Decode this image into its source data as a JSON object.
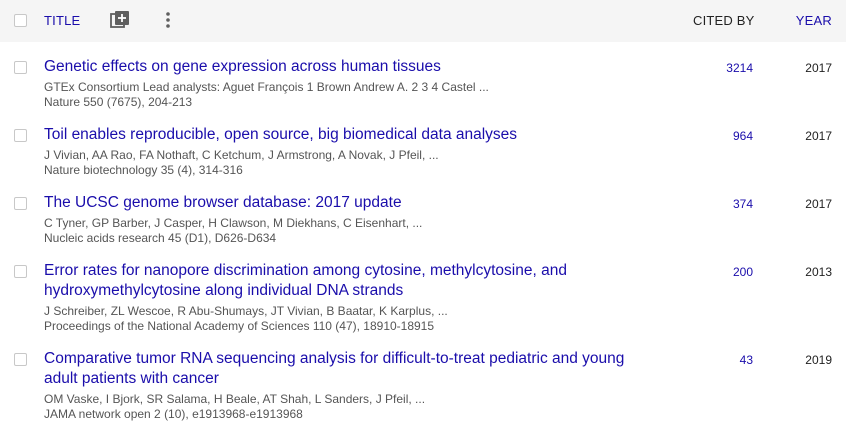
{
  "header": {
    "title_label": "TITLE",
    "cited_by_label": "CITED BY",
    "year_label": "YEAR",
    "icons": [
      "add-article-icon",
      "more-vert-icon"
    ]
  },
  "articles": [
    {
      "title": "Genetic effects on gene expression across human tissues",
      "authors": "GTEx Consortium Lead analysts: Aguet François 1 Brown Andrew A. 2 3 4 Castel ...",
      "source": "Nature 550 (7675), 204-213",
      "cited_by": "3214",
      "year": "2017"
    },
    {
      "title": "Toil enables reproducible, open source, big biomedical data analyses",
      "authors": "J Vivian, AA Rao, FA Nothaft, C Ketchum, J Armstrong, A Novak, J Pfeil, ...",
      "source": "Nature biotechnology 35 (4), 314-316",
      "cited_by": "964",
      "year": "2017"
    },
    {
      "title": "The UCSC genome browser database: 2017 update",
      "authors": "C Tyner, GP Barber, J Casper, H Clawson, M Diekhans, C Eisenhart, ...",
      "source": "Nucleic acids research 45 (D1), D626-D634",
      "cited_by": "374",
      "year": "2017"
    },
    {
      "title_line1": "Error rates for nanopore discrimination among cytosine, methylcytosine, and",
      "title_line2": "hydroxymethylcytosine along individual DNA strands",
      "authors": "J Schreiber, ZL Wescoe, R Abu-Shumays, JT Vivian, B Baatar, K Karplus, ...",
      "source": "Proceedings of the National Academy of Sciences 110 (47), 18910-18915",
      "cited_by": "200",
      "year": "2013"
    },
    {
      "title_line1": "Comparative tumor RNA sequencing analysis for difficult-to-treat pediatric and young",
      "title_line2": "adult patients with cancer",
      "authors": "OM Vaske, I Bjork, SR Salama, H Beale, AT Shah, L Sanders, J Pfeil, ...",
      "source": "JAMA network open 2 (10), e1913968-e1913968",
      "cited_by": "43",
      "year": "2019"
    }
  ]
}
